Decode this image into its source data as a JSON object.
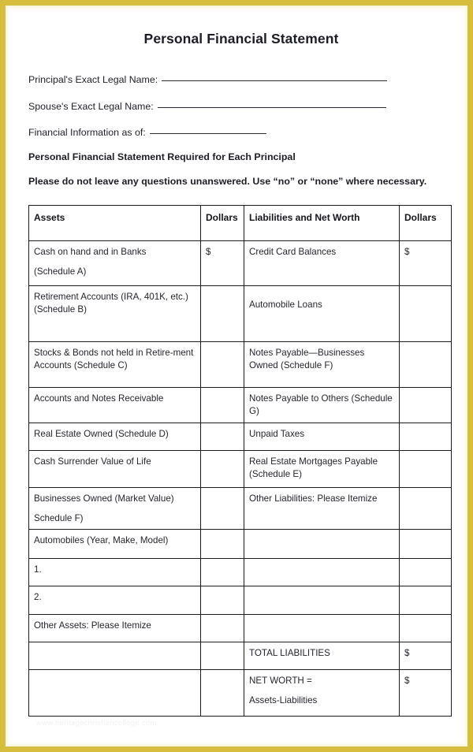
{
  "document": {
    "title": "Personal Financial Statement",
    "fields": [
      {
        "label": "Principal's Exact Legal Name:",
        "value": ""
      },
      {
        "label": "Spouse's Exact Legal Name:",
        "value": ""
      },
      {
        "label": "Financial Information as of:",
        "value": ""
      }
    ],
    "notes": [
      "Personal Financial Statement Required for Each Principal",
      "Please do not leave any questions unanswered. Use “no” or “none” where necessary."
    ],
    "watermark": "www.heritagechristiancollege.com"
  },
  "table": {
    "headers": {
      "assets": "Assets",
      "dollars_assets": "Dollars",
      "liabilities": "Liabilities and Net Worth",
      "dollars_liabilities": "Dollars"
    },
    "currency_symbol": "$",
    "rows": [
      {
        "asset": "Cash on hand and in Banks",
        "asset_sub": "(Schedule A)",
        "asset_dollars": "$",
        "liability": "Credit Card Balances",
        "liability_sub": "",
        "liability_dollars": "$"
      },
      {
        "asset": "Retirement Accounts (IRA, 401K, etc.)",
        "asset_sub": "(Schedule B)",
        "asset_dollars": "",
        "liability": "Automobile Loans",
        "liability_sub": "",
        "liability_dollars": ""
      },
      {
        "asset": "Stocks & Bonds not held in Retire-ment Accounts (Schedule C)",
        "asset_sub": "",
        "asset_dollars": "",
        "liability": "Notes Payable—Businesses Owned (Schedule F)",
        "liability_sub": "",
        "liability_dollars": ""
      },
      {
        "asset": "Accounts and Notes Receivable",
        "asset_sub": "",
        "asset_dollars": "",
        "liability": "Notes Payable to Others (Schedule G)",
        "liability_sub": "",
        "liability_dollars": ""
      },
      {
        "asset": "Real Estate Owned (Schedule D)",
        "asset_sub": "",
        "asset_dollars": "",
        "liability": "Unpaid Taxes",
        "liability_sub": "",
        "liability_dollars": ""
      },
      {
        "asset": "Cash Surrender Value of Life",
        "asset_sub": "",
        "asset_dollars": "",
        "liability": "Real Estate Mortgages Payable (Schedule E)",
        "liability_sub": "",
        "liability_dollars": ""
      },
      {
        "asset": "Businesses Owned (Market Value)",
        "asset_sub": "Schedule F)",
        "asset_dollars": "",
        "liability": "Other Liabilities: Please Itemize",
        "liability_sub": "",
        "liability_dollars": ""
      },
      {
        "asset": "Automobiles (Year, Make, Model)",
        "asset_sub": "",
        "asset_dollars": "",
        "liability": "",
        "liability_sub": "",
        "liability_dollars": ""
      },
      {
        "asset": "1.",
        "asset_sub": "",
        "asset_dollars": "",
        "liability": "",
        "liability_sub": "",
        "liability_dollars": ""
      },
      {
        "asset": "2.",
        "asset_sub": "",
        "asset_dollars": "",
        "liability": "",
        "liability_sub": "",
        "liability_dollars": ""
      },
      {
        "asset": "Other Assets: Please Itemize",
        "asset_sub": "",
        "asset_dollars": "",
        "liability": "",
        "liability_sub": "",
        "liability_dollars": ""
      },
      {
        "asset": "",
        "asset_sub": "",
        "asset_dollars": "",
        "liability": "TOTAL LIABILITIES",
        "liability_sub": "",
        "liability_dollars": "$"
      },
      {
        "asset": "",
        "asset_sub": "",
        "asset_dollars": "",
        "liability": "NET WORTH  =",
        "liability_sub": "Assets-Liabilities",
        "liability_dollars": "$"
      }
    ]
  },
  "theme": {
    "border_gold": "#d6bd3d",
    "page_background": "#ffffff",
    "text_color": "#25252d",
    "table_line": "#1c1c1c"
  }
}
